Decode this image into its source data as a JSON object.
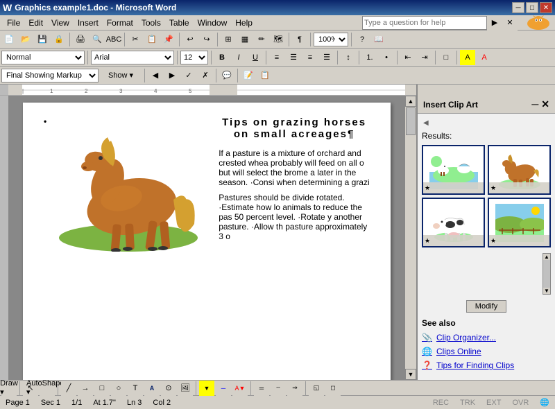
{
  "titlebar": {
    "title": "Graphics example1.doc - Microsoft Word",
    "minimize": "─",
    "maximize": "□",
    "close": "✕"
  },
  "menubar": {
    "items": [
      "File",
      "Edit",
      "View",
      "Insert",
      "Format",
      "Tools",
      "Table",
      "Window",
      "Help"
    ]
  },
  "help_search": {
    "placeholder": "Type a question for help"
  },
  "formatting_toolbar": {
    "style": "Normal",
    "font": "Arial",
    "size": "12",
    "bold": "B",
    "italic": "I",
    "underline": "U"
  },
  "markup_toolbar": {
    "mode": "Final Showing Markup",
    "show": "Show ▾"
  },
  "document": {
    "title": "Tips on grazing horses on small acreages¶",
    "bullet": "•",
    "para1": "If a pasture is a mixture of orchard and crested whea probably will feed on all o but will select the brome a later in the season. ·Consi when determining a grazi",
    "para2": "Pastures should be divide rotated. ·Estimate how lo animals to reduce the pas 50 percent level. ·Rotate y another pasture. ·Allow th pasture approximately 3 o"
  },
  "clip_art_panel": {
    "title": "Insert Clip Art",
    "results_label": "Results:",
    "modify_btn": "Modify",
    "see_also": "See also",
    "see_also_items": [
      {
        "label": "Clip Organizer...",
        "icon": "📎"
      },
      {
        "label": "Clips Online",
        "icon": "🌐"
      },
      {
        "label": "Tips for Finding Clips",
        "icon": "❓"
      }
    ]
  },
  "statusbar": {
    "page": "Page 1",
    "sec": "Sec 1",
    "page_count": "1/1",
    "at": "At 1.7\"",
    "ln": "Ln 3",
    "col": "Col 2",
    "rec": "REC",
    "trk": "TRK",
    "ext": "EXT",
    "ovr": "OVR"
  },
  "draw_toolbar": {
    "draw_label": "Draw ▾",
    "autoshapes": "AutoShapes ▾"
  }
}
